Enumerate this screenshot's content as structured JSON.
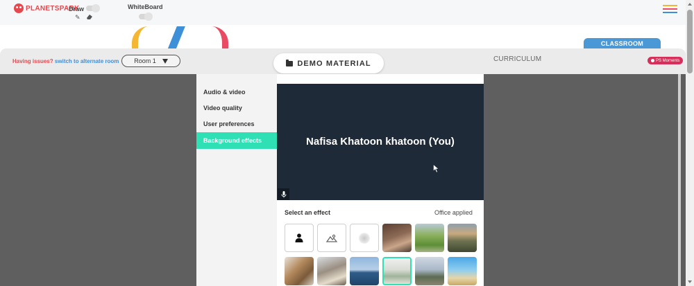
{
  "brand": {
    "name": "PLANETSPARK"
  },
  "toolbar": {
    "draw_label": "Draw",
    "whiteboard_label": "WhiteBoard",
    "icons": [
      "pencil-icon",
      "eraser-icon",
      "hamburger-icon"
    ]
  },
  "nav": {
    "issues_prefix": "Having issues?",
    "issues_link": "switch to alternate room",
    "room_selected": "Room 1",
    "demo_material_label": "DEMO MATERIAL",
    "curriculum_label": "CURRICULUM",
    "classroom_label": "CLASSROOM",
    "moments_label": "PS Moments"
  },
  "settings": {
    "menu": [
      {
        "label": "Audio & video",
        "active": false
      },
      {
        "label": "Video quality",
        "active": false
      },
      {
        "label": "User preferences",
        "active": false
      },
      {
        "label": "Background effects",
        "active": true
      }
    ],
    "preview_name": "Nafisa Khatoon khatoon (You)",
    "effects_title": "Select an effect",
    "effects_status": "Office applied",
    "effects": [
      {
        "name": "none",
        "icon": "person-icon"
      },
      {
        "name": "slight-blur",
        "icon": "landscape-icon"
      },
      {
        "name": "blur",
        "icon": "blur-icon"
      },
      {
        "name": "brick-room"
      },
      {
        "name": "park"
      },
      {
        "name": "mountains"
      },
      {
        "name": "bookshelf"
      },
      {
        "name": "loft"
      },
      {
        "name": "ocean"
      },
      {
        "name": "office",
        "selected": true
      },
      {
        "name": "plants"
      },
      {
        "name": "beach-chair"
      }
    ]
  },
  "colors": {
    "accent": "#2fe0b4",
    "brand_red": "#e5484d",
    "link_blue": "#3d8fd8",
    "classroom_blue": "#4a98d6",
    "preview_bg": "#1f2a38",
    "stage_bg": "#5f5f5f",
    "moments_pink": "#d62f5a"
  }
}
